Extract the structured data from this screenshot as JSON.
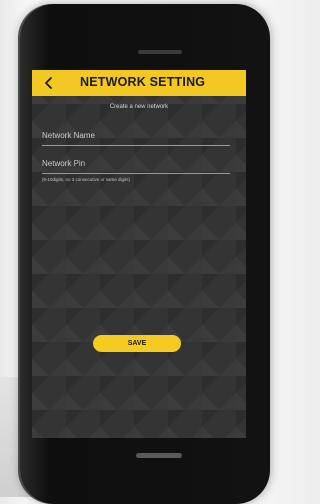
{
  "header": {
    "title": "NETWORK SETTING",
    "back_icon": "chevron-left-icon"
  },
  "form": {
    "subtitle": "Create a new network",
    "network_name": {
      "placeholder": "Network Name",
      "value": ""
    },
    "network_pin": {
      "placeholder": "Network Pin",
      "value": ""
    },
    "pin_hint": "(6-10digits, no 3 consecutive or same digits)"
  },
  "actions": {
    "save_label": "SAVE"
  },
  "colors": {
    "accent": "#f4c822",
    "screen_background": "#343434"
  }
}
